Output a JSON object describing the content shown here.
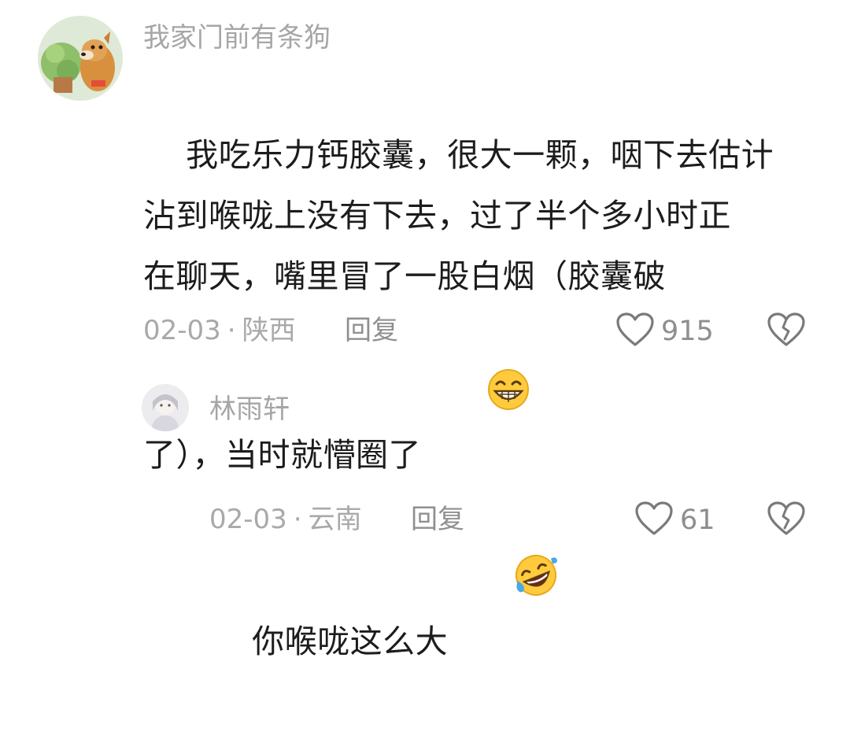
{
  "comments": [
    {
      "author": "我家门前有条狗",
      "text": "我吃乐力钙胶囊，很大一颗，咽下去估计\n沾到喉咙上没有下去，过了半个多小时正\n在聊天，嘴里冒了一股白烟（胶囊破\n了），当时就懵圈了",
      "emoji_icon": "grinning-face-icon",
      "date": "02-03",
      "separator": "·",
      "location": "陕西",
      "reply_label": "回复",
      "like_count": "915"
    },
    {
      "author": "林雨轩",
      "text": "你喉咙这么大",
      "emoji_icon": "rolling-on-floor-laughing-icon",
      "date": "02-03",
      "separator": "·",
      "location": "云南",
      "reply_label": "回复",
      "like_count": "61"
    }
  ]
}
